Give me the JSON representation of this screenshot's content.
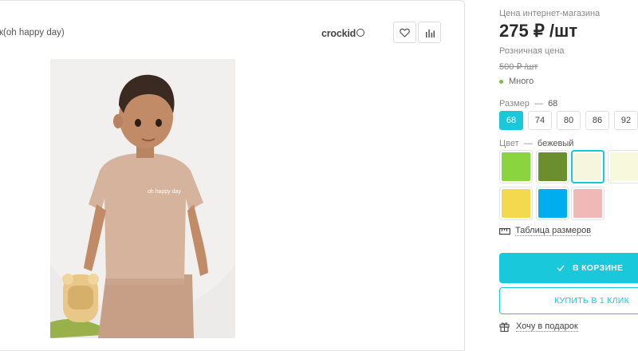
{
  "product": {
    "title": "к(oh happy day)",
    "brand": "crockid",
    "photo_print_text": "oh happy day"
  },
  "pricing": {
    "online_label": "Цена интернет-магазина",
    "online_price": "275 ₽ /шт",
    "retail_label": "Розничная цена",
    "retail_price": "500 ₽ /шт"
  },
  "stock": {
    "status": "Много",
    "color": "#7ac142"
  },
  "size": {
    "label": "Размер",
    "dash": "—",
    "selected": "68",
    "options": [
      "68",
      "74",
      "80",
      "86",
      "92"
    ]
  },
  "color": {
    "label": "Цвет",
    "dash": "—",
    "selected": "бежевый",
    "swatches": [
      "#8ad43f",
      "#6b8e2e",
      "#f6f6de",
      "#f8f8dd",
      "#f3d94d",
      "#00aef0",
      "#f1b8b8"
    ],
    "accent": "#19c8db"
  },
  "links": {
    "size_table": "Таблица размеров",
    "gift": "Хочу в подарок"
  },
  "buttons": {
    "cart": "В КОРЗИНЕ",
    "one_click": "КУПИТЬ В 1 КЛИК"
  },
  "icons": {
    "favorite": "heart-icon",
    "compare": "bar-chart-icon",
    "cart_state": "checkmark-icon",
    "size_table": "ruler-icon",
    "gift": "gift-icon"
  }
}
